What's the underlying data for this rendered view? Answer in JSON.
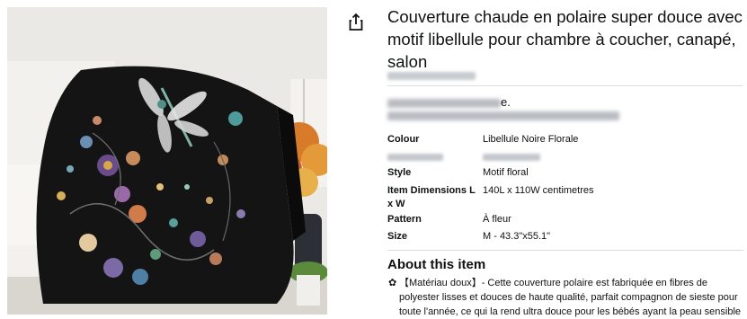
{
  "product": {
    "title": "Couverture chaude en polaire super douce avec motif libellule pour chambre à coucher, canapé, salon",
    "share_icon": "share-icon",
    "image_alt": "Black fleece blanket with dragonfly and floral pattern draped over a white sofa"
  },
  "overview_suffix": "e.",
  "specs": [
    {
      "label": "Colour",
      "value": "Libellule Noire Florale"
    },
    {
      "label": "Style",
      "value": "Motif floral"
    },
    {
      "label": "Item Dimensions L x W",
      "value": "140L x 110W centimetres"
    },
    {
      "label": "Pattern",
      "value": "À fleur"
    },
    {
      "label": "Size",
      "value": "M - 43.3\"x55.1\""
    }
  ],
  "about": {
    "heading": "About this item",
    "items": [
      {
        "bullet": "✿",
        "text": "【Matériau doux】- Cette couverture polaire est fabriquée en fibres de polyester lisses et douces de haute qualité, parfait compagnon de sieste pour toute l'année, ce qui la rend ultra douce pour les bébés ayant la peau sensible"
      }
    ]
  },
  "colors": {
    "text": "#0f1111",
    "divider": "#dddddd",
    "blanket": "#141414",
    "wall": "#e9e7e3"
  }
}
